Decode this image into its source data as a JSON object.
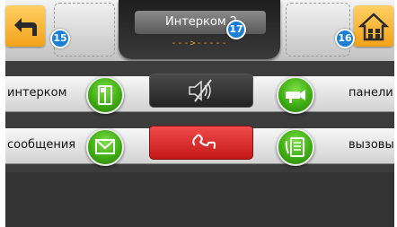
{
  "header": {
    "title": "Интерком 2",
    "subtitle": "--->-----",
    "back_badge": "15",
    "home_badge": "16",
    "title_badge": "17"
  },
  "rows": {
    "intercom_label": "интерком",
    "panels_label": "панели",
    "messages_label": "сообщения",
    "calls_label": "вызовы"
  },
  "colors": {
    "accent_orange": "#f2a21a",
    "badge_blue": "#1a7fd6",
    "green_button": "#3fae12",
    "call_red": "#d42020",
    "panel_dark": "#3c3c3c"
  }
}
